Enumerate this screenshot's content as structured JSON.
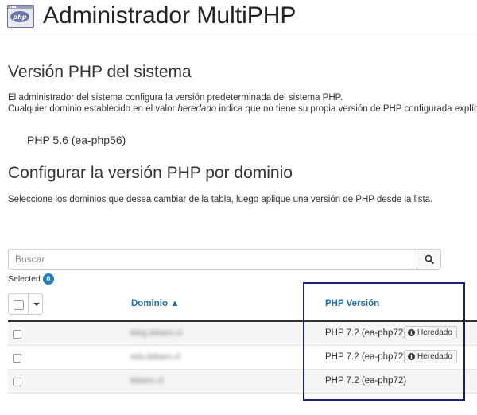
{
  "header": {
    "icon_label": "php",
    "title": "Administrador MultiPHP"
  },
  "system": {
    "heading": "Versión PHP del sistema",
    "line1": "El administrador del sistema configura la versión predeterminada del sistema PHP.",
    "line2_pre": "Cualquier dominio establecido en el valor ",
    "line2_em": "heredado",
    "line2_post": " indica que no tiene su propia versión de PHP configurada explíc",
    "current_version": "PHP 5.6 (ea-php56)"
  },
  "per_domain": {
    "heading": "Configurar la versión PHP por dominio",
    "description": "Seleccione los dominios que desea cambiar de la tabla, luego aplique una versión de PHP desde la lista."
  },
  "search": {
    "placeholder": "Buscar",
    "icon": "search-icon"
  },
  "selection": {
    "label": "Selected",
    "count": "0"
  },
  "table": {
    "columns": {
      "domain": "Dominio ▲",
      "php_version": "PHP Versión"
    },
    "rows": [
      {
        "domain": "blog.lebaro.cl",
        "version": "PHP 7.2 (ea-php72)",
        "badge": "Heredado"
      },
      {
        "domain": "edu.lebaro.cl",
        "version": "PHP 7.2 (ea-php72)",
        "badge": "Heredado"
      },
      {
        "domain": "lebaro.cl",
        "version": "PHP 7.2 (ea-php72)",
        "badge": ""
      }
    ]
  },
  "colors": {
    "link_blue": "#1f6fa8",
    "badge_blue": "#1f7fb6",
    "highlight_navy": "#1c2070"
  }
}
